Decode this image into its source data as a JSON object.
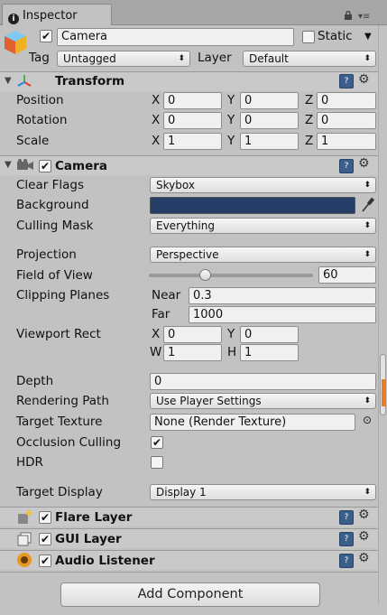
{
  "window": {
    "tab_label": "Inspector"
  },
  "object": {
    "name": "Camera",
    "active": true,
    "static_label": "Static",
    "static_checked": false,
    "tag_label": "Tag",
    "tag_value": "Untagged",
    "layer_label": "Layer",
    "layer_value": "Default"
  },
  "transform": {
    "title": "Transform",
    "position": {
      "label": "Position",
      "x": "0",
      "y": "0",
      "z": "0"
    },
    "rotation": {
      "label": "Rotation",
      "x": "0",
      "y": "0",
      "z": "0"
    },
    "scale": {
      "label": "Scale",
      "x": "1",
      "y": "1",
      "z": "1"
    },
    "axis_x": "X",
    "axis_y": "Y",
    "axis_z": "Z"
  },
  "camera": {
    "title": "Camera",
    "enabled": true,
    "clear_flags": {
      "label": "Clear Flags",
      "value": "Skybox"
    },
    "background": {
      "label": "Background",
      "color": "#243e67"
    },
    "culling_mask": {
      "label": "Culling Mask",
      "value": "Everything"
    },
    "projection": {
      "label": "Projection",
      "value": "Perspective"
    },
    "field_of_view": {
      "label": "Field of View",
      "value": "60",
      "fraction": 0.34
    },
    "clipping_planes": {
      "label": "Clipping Planes",
      "near_label": "Near",
      "near": "0.3",
      "far_label": "Far",
      "far": "1000"
    },
    "viewport_rect": {
      "label": "Viewport Rect",
      "x_label": "X",
      "x": "0",
      "y_label": "Y",
      "y": "0",
      "w_label": "W",
      "w": "1",
      "h_label": "H",
      "h": "1"
    },
    "depth": {
      "label": "Depth",
      "value": "0"
    },
    "rendering_path": {
      "label": "Rendering Path",
      "value": "Use Player Settings"
    },
    "target_texture": {
      "label": "Target Texture",
      "value": "None (Render Texture)"
    },
    "occlusion_culling": {
      "label": "Occlusion Culling",
      "checked": true
    },
    "hdr": {
      "label": "HDR",
      "checked": false
    },
    "target_display": {
      "label": "Target Display",
      "value": "Display 1"
    }
  },
  "components": [
    {
      "title": "Flare Layer",
      "enabled": true
    },
    {
      "title": "GUI Layer",
      "enabled": true
    },
    {
      "title": "Audio Listener",
      "enabled": true
    }
  ],
  "add_component_label": "Add Component",
  "colors": {
    "accent_scroll": "#e87e21",
    "help_icon": "#3b5f8a"
  }
}
